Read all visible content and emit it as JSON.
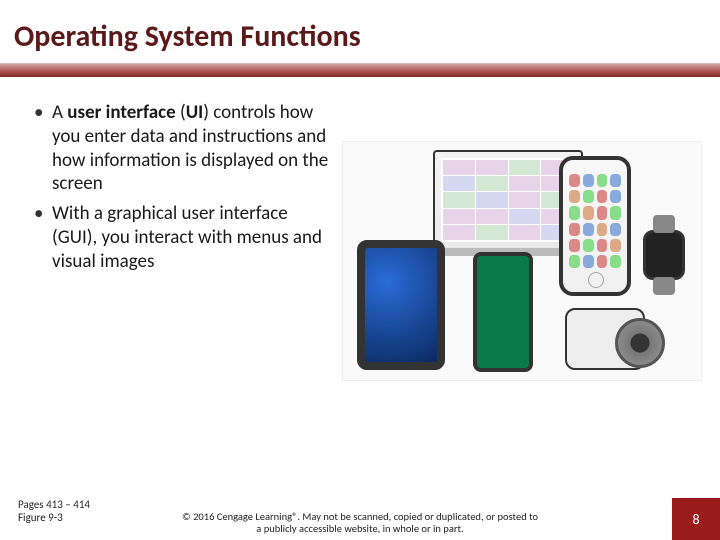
{
  "title": "Operating System Functions",
  "bullets": [
    {
      "prefix": "A ",
      "bold": "user interface",
      "after_bold": " (",
      "bold2": "UI",
      "after_bold2": ") controls how you enter data and instructions and how information is displayed on the screen"
    },
    {
      "plain": "With a graphical user interface (GUI), you interact with menus and visual images"
    }
  ],
  "footer": {
    "pages": "Pages 413 – 414",
    "figure": "Figure 9-3",
    "copyright": "© 2016 Cengage Learning®. May not be scanned, copied or duplicated, or posted to a publicly accessible website, in whole or in part."
  },
  "page_number": "8"
}
